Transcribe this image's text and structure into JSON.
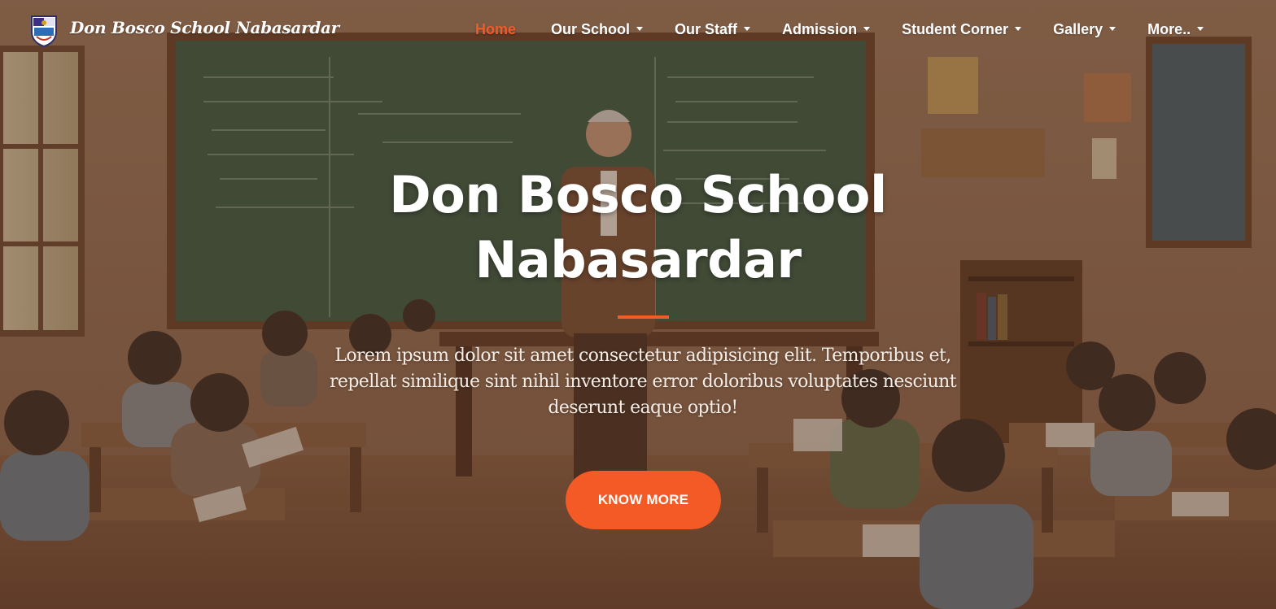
{
  "header": {
    "brand": "Don Bosco School Nabasardar",
    "nav": [
      {
        "label": "Home",
        "active": true,
        "dropdown": false
      },
      {
        "label": "Our School",
        "active": false,
        "dropdown": true
      },
      {
        "label": "Our Staff",
        "active": false,
        "dropdown": true
      },
      {
        "label": "Admission",
        "active": false,
        "dropdown": true
      },
      {
        "label": "Student Corner",
        "active": false,
        "dropdown": true
      },
      {
        "label": "Gallery",
        "active": false,
        "dropdown": true
      },
      {
        "label": "More..",
        "active": false,
        "dropdown": true
      }
    ]
  },
  "hero": {
    "title_line1": "Don Bosco School",
    "title_line2": "Nabasardar",
    "lead_line1": "Lorem ipsum dolor sit amet consectetur adipisicing elit. Temporibus et,",
    "lead_line2": "repellat similique sint nihil inventore error doloribus voluptates nesciunt",
    "lead_line3": "deserunt eaque optio!",
    "cta_label": "KNOW MORE"
  },
  "colors": {
    "accent": "#f25b2a",
    "button": "#f45a25",
    "text": "#ffffff",
    "overlay": "#4a2c1c"
  },
  "icons": {
    "logo": "school-crest-icon",
    "caret": "caret-down-icon"
  }
}
